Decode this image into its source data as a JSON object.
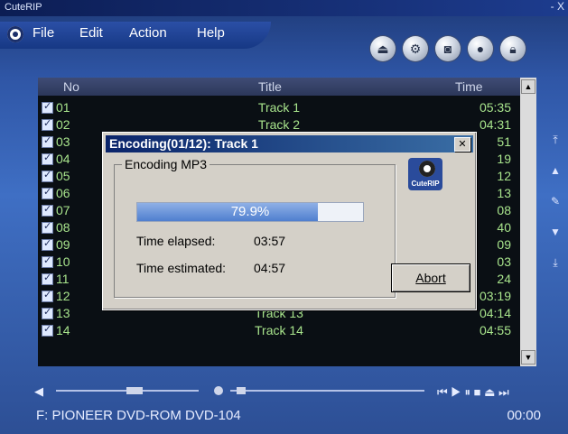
{
  "window": {
    "title": "CuteRIP",
    "close_glyph": "- X"
  },
  "menu": {
    "items": [
      "File",
      "Edit",
      "Action",
      "Help"
    ]
  },
  "toolbar": {
    "icons": [
      "eject-icon",
      "settings-icon",
      "cddb-icon",
      "record-icon",
      "lock-icon"
    ]
  },
  "grid": {
    "columns": {
      "no": "No",
      "title": "Title",
      "time": "Time"
    },
    "rows": [
      {
        "no": "01",
        "title": "Track 1",
        "time": "05:35"
      },
      {
        "no": "02",
        "title": "Track 2",
        "time": "04:31"
      },
      {
        "no": "03",
        "title": "",
        "time": "51"
      },
      {
        "no": "04",
        "title": "",
        "time": "19"
      },
      {
        "no": "05",
        "title": "",
        "time": "12"
      },
      {
        "no": "06",
        "title": "",
        "time": "13"
      },
      {
        "no": "07",
        "title": "",
        "time": "08"
      },
      {
        "no": "08",
        "title": "",
        "time": "40"
      },
      {
        "no": "09",
        "title": "",
        "time": "09"
      },
      {
        "no": "10",
        "title": "",
        "time": "03"
      },
      {
        "no": "11",
        "title": "",
        "time": "24"
      },
      {
        "no": "12",
        "title": "Track 12",
        "time": "03:19"
      },
      {
        "no": "13",
        "title": "Track 13",
        "time": "04:14"
      },
      {
        "no": "14",
        "title": "Track 14",
        "time": "04:55"
      }
    ]
  },
  "dialog": {
    "title": "Encoding(01/12): Track 1",
    "group_label": "Encoding MP3",
    "progress_percent": 79.9,
    "progress_text": "79.9%",
    "elapsed_label": "Time elapsed:",
    "elapsed_value": "03:57",
    "estimated_label": "Time estimated:",
    "estimated_value": "04:57",
    "abort_label": "Abort",
    "logo_text": "CuteRIP"
  },
  "status": {
    "drive": "F:  PIONEER DVD-ROM DVD-104",
    "time": "00:00"
  },
  "colors": {
    "accent": "#3f6fc4",
    "progress": "#4f7fcf",
    "row_text": "#a8e48c"
  }
}
